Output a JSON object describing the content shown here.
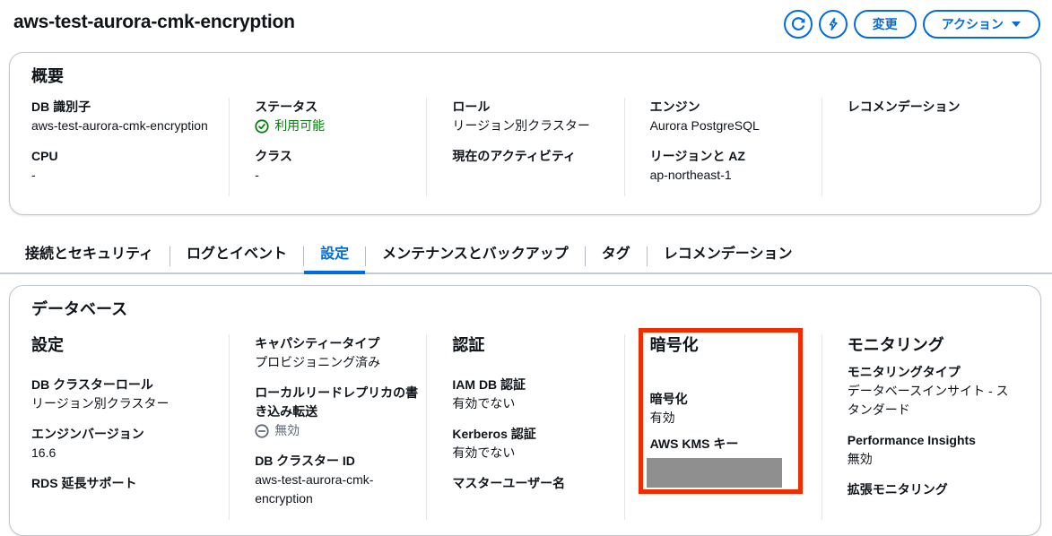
{
  "header": {
    "title": "aws-test-aurora-cmk-encryption",
    "modify_label": "変更",
    "actions_label": "アクション"
  },
  "icons": {
    "refresh": "circular-refresh-arrow",
    "boost": "lightning-bolt",
    "actions_caret": "caret-down",
    "status_ok": "check-circle",
    "disabled": "minus-circle"
  },
  "colors": {
    "accent": "#006ce0",
    "success": "#037f0c",
    "muted": "#5f6b7a",
    "highlight_red": "#f02d00",
    "redaction_gray": "#8f8f8f"
  },
  "overview": {
    "heading": "概要",
    "columns": [
      {
        "fields": [
          {
            "label": "DB 識別子",
            "value": "aws-test-aurora-cmk-encryption"
          },
          {
            "label": "CPU",
            "value": "-"
          }
        ]
      },
      {
        "fields": [
          {
            "label": "ステータス",
            "value": "利用可能",
            "status": "success"
          },
          {
            "label": "クラス",
            "value": "-"
          }
        ]
      },
      {
        "fields": [
          {
            "label": "ロール",
            "value": "リージョン別クラスター"
          },
          {
            "label": "現在のアクティビティ",
            "value": ""
          }
        ]
      },
      {
        "fields": [
          {
            "label": "エンジン",
            "value": "Aurora PostgreSQL"
          },
          {
            "label": "リージョンと AZ",
            "value": "ap-northeast-1"
          }
        ]
      },
      {
        "fields": [
          {
            "label": "レコメンデーション",
            "value": ""
          }
        ]
      }
    ]
  },
  "tabs": {
    "active_index": 2,
    "items": [
      {
        "label": "接続とセキュリティ"
      },
      {
        "label": "ログとイベント"
      },
      {
        "label": "設定"
      },
      {
        "label": "メンテナンスとバックアップ"
      },
      {
        "label": "タグ"
      },
      {
        "label": "レコメンデーション"
      }
    ]
  },
  "database": {
    "heading": "データベース",
    "columns": [
      {
        "heading": "設定",
        "fields": [
          {
            "label": "DB クラスターロール",
            "value": "リージョン別クラスター"
          },
          {
            "label": "エンジンバージョン",
            "value": "16.6"
          },
          {
            "label": "RDS 延長サポート",
            "value": ""
          }
        ]
      },
      {
        "heading": "",
        "fields": [
          {
            "label": "キャパシティータイプ",
            "value": "プロビジョニング済み"
          },
          {
            "label": "ローカルリードレプリカの書き込み転送",
            "value": "無効",
            "status": "disabled"
          },
          {
            "label": "DB クラスター ID",
            "value": "aws-test-aurora-cmk-encryption"
          }
        ]
      },
      {
        "heading": "認証",
        "fields": [
          {
            "label": "IAM DB 認証",
            "value": "有効でない"
          },
          {
            "label": "Kerberos 認証",
            "value": "有効でない"
          },
          {
            "label": "マスターユーザー名",
            "value": ""
          }
        ]
      },
      {
        "heading": "暗号化",
        "highlighted": true,
        "fields": [
          {
            "label": "暗号化",
            "value": "有効"
          },
          {
            "label": "AWS KMS キー",
            "value": "",
            "redacted": true
          }
        ]
      },
      {
        "heading": "モニタリング",
        "fields": [
          {
            "label": "モニタリングタイプ",
            "value": "データベースインサイト - スタンダード"
          },
          {
            "label": "Performance Insights",
            "value": "無効"
          },
          {
            "label": "拡張モニタリング",
            "value": ""
          }
        ]
      }
    ]
  }
}
